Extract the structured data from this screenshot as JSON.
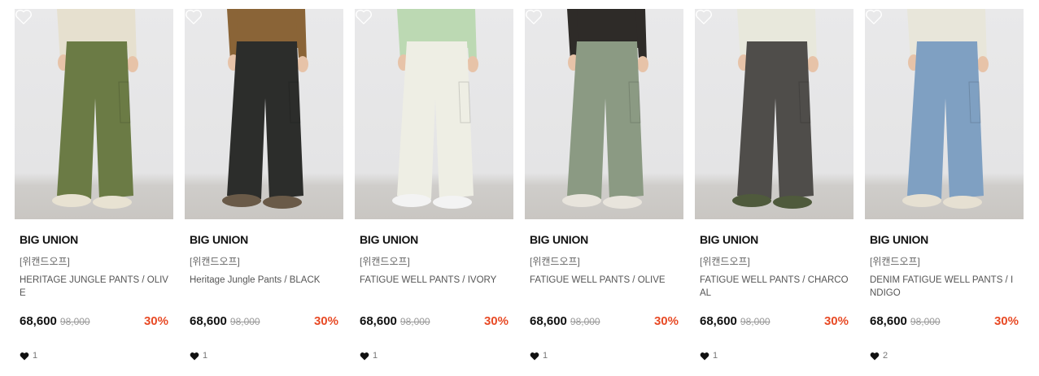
{
  "products": [
    {
      "brand": "BIG UNION",
      "seller": "[위캔드오프]",
      "name": "HERITAGE JUNGLE PANTS / OLIVE",
      "price": "68,600",
      "original_price": "98,000",
      "discount": "30%",
      "likes": "1",
      "wish_icon": "heart-outline-icon",
      "colors": {
        "pants": "#6b7b45",
        "top": "#e6e0cf",
        "shoe": "#e8e2d2"
      }
    },
    {
      "brand": "BIG UNION",
      "seller": "[위캔드오프]",
      "name": "Heritage Jungle Pants / BLACK",
      "price": "68,600",
      "original_price": "98,000",
      "discount": "30%",
      "likes": "1",
      "wish_icon": "heart-outline-icon",
      "colors": {
        "pants": "#2c2d2b",
        "top": "#8a6437",
        "shoe": "#6a5a48"
      }
    },
    {
      "brand": "BIG UNION",
      "seller": "[위캔드오프]",
      "name": "FATIGUE WELL PANTS / IVORY",
      "price": "68,600",
      "original_price": "98,000",
      "discount": "30%",
      "likes": "1",
      "wish_icon": "heart-outline-icon",
      "colors": {
        "pants": "#eeeee4",
        "top": "#bcd9b3",
        "shoe": "#f3f3f3"
      }
    },
    {
      "brand": "BIG UNION",
      "seller": "[위캔드오프]",
      "name": "FATIGUE WELL PANTS / OLIVE",
      "price": "68,600",
      "original_price": "98,000",
      "discount": "30%",
      "likes": "1",
      "wish_icon": "heart-outline-icon",
      "colors": {
        "pants": "#8b9a83",
        "top": "#2e2b28",
        "shoe": "#e8e4dc"
      }
    },
    {
      "brand": "BIG UNION",
      "seller": "[위캔드오프]",
      "name": "FATIGUE WELL PANTS / CHARCOAL",
      "price": "68,600",
      "original_price": "98,000",
      "discount": "30%",
      "likes": "1",
      "wish_icon": "heart-outline-icon",
      "colors": {
        "pants": "#4f4d4a",
        "top": "#e8e8dc",
        "shoe": "#4f5a3c"
      }
    },
    {
      "brand": "BIG UNION",
      "seller": "[위캔드오프]",
      "name": "DENIM FATIGUE WELL PANTS / INDIGO",
      "price": "68,600",
      "original_price": "98,000",
      "discount": "30%",
      "likes": "2",
      "wish_icon": "heart-outline-icon",
      "colors": {
        "pants": "#7fa0c2",
        "top": "#e8e6da",
        "shoe": "#e6e0d2"
      }
    }
  ],
  "like_icon": "heart-filled-icon",
  "discount_color": "#e84a25"
}
